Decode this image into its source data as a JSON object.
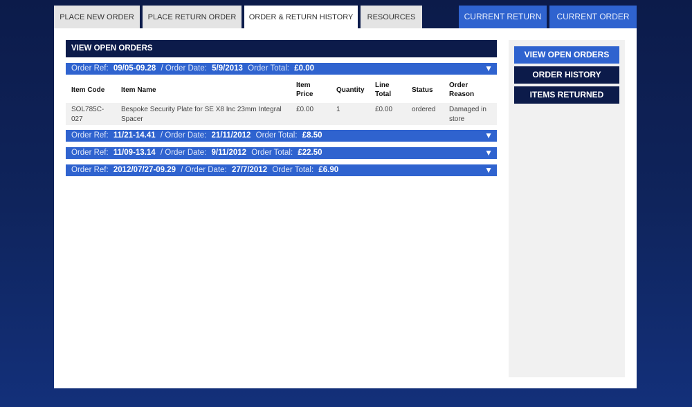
{
  "tabs": [
    {
      "label": "PLACE NEW ORDER",
      "active": false
    },
    {
      "label": "PLACE RETURN ORDER",
      "active": false
    },
    {
      "label": "ORDER & RETURN HISTORY",
      "active": true
    },
    {
      "label": "RESOURCES",
      "active": false
    }
  ],
  "top_buttons": {
    "current_return": "CURRENT RETURN",
    "current_order": "CURRENT ORDER"
  },
  "main": {
    "section_title": "VIEW OPEN ORDERS",
    "labels": {
      "order_ref": "Order Ref:",
      "order_date": "/ Order Date:",
      "order_total": "Order Total:",
      "expand_arrow": "▼"
    },
    "orders": [
      {
        "ref": "09/05-09.28",
        "date": "5/9/2013",
        "total": "£0.00",
        "expanded": true
      },
      {
        "ref": "11/21-14.41",
        "date": "21/11/2012",
        "total": "£8.50",
        "expanded": false
      },
      {
        "ref": "11/09-13.14",
        "date": "9/11/2012",
        "total": "£22.50",
        "expanded": false
      },
      {
        "ref": "2012/07/27-09.29",
        "date": "27/7/2012",
        "total": "£6.90",
        "expanded": false
      }
    ],
    "table": {
      "headers": [
        "Item Code",
        "Item Name",
        "Item Price",
        "Quantity",
        "Line Total",
        "Status",
        "Order Reason"
      ],
      "rows": [
        {
          "code": "SOL785C-027",
          "name": "Bespoke Security Plate for SE X8 Inc 23mm Integral Spacer",
          "price": "£0.00",
          "quantity": "1",
          "line_total": "£0.00",
          "status": "ordered",
          "reason": "Damaged in store"
        }
      ]
    }
  },
  "sidebar": {
    "items": [
      {
        "label": "VIEW OPEN ORDERS",
        "active": true
      },
      {
        "label": "ORDER HISTORY",
        "active": false
      },
      {
        "label": "ITEMS RETURNED",
        "active": false
      }
    ]
  },
  "colors": {
    "navy": "#0c1b4a",
    "accent_blue": "#2f63cf",
    "tab_grey": "#e4e4e4",
    "sidebar_grey": "#f1f1f1"
  }
}
